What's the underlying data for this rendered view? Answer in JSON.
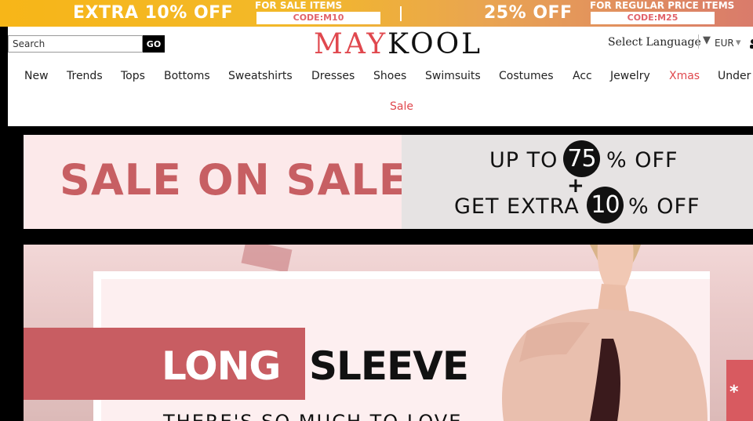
{
  "promo": {
    "left_big": "EXTRA 10% OFF",
    "left_small": "FOR SALE ITEMS",
    "left_code": "CODE:M10",
    "right_big": "25% OFF",
    "right_small": "FOR REGULAR PRICE ITEMS",
    "right_code": "CODE:M25"
  },
  "header": {
    "search_placeholder": "Search",
    "search_button": "GO",
    "logo_part1": "MAY",
    "logo_part2": "KOOL",
    "language_label": "Select Language",
    "currency": "EUR"
  },
  "nav": {
    "items": [
      "New",
      "Trends",
      "Tops",
      "Bottoms",
      "Sweatshirts",
      "Dresses",
      "Shoes",
      "Swimsuits",
      "Costumes",
      "Acc",
      "Jewelry",
      "Xmas",
      "Under"
    ],
    "sale": "Sale"
  },
  "sale_banner": {
    "title": "SALE ON SALE",
    "line1_pre": "UP TO",
    "line1_num": "75",
    "line1_post": "% OFF",
    "plus": "+",
    "line2_pre": "GET EXTRA",
    "line2_num": "10",
    "line2_post": "% OFF"
  },
  "hero": {
    "word1": "LONG",
    "word2": "SLEEVE",
    "subtitle": "THERE'S SO MUCH TO LOVE"
  },
  "colors": {
    "accent": "#e0484e",
    "sale_pink": "#c75f63"
  }
}
